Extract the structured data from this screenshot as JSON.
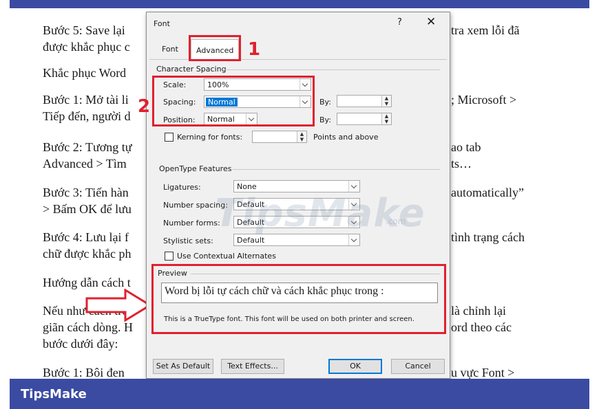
{
  "background": {
    "lines": [
      {
        "id": "l1a",
        "text": "Bước 5: Save lại"
      },
      {
        "id": "l1b",
        "text": "được khắc phục c"
      },
      {
        "id": "r1",
        "text": "tra xem lỗi đã"
      },
      {
        "id": "l2",
        "text": "Khắc phục Word"
      },
      {
        "id": "l3a",
        "text": "Bước 1: Mở tài li"
      },
      {
        "id": "l3b",
        "text": "Tiếp đến, người d"
      },
      {
        "id": "r3",
        "text": "; Microsoft >"
      },
      {
        "id": "l4a",
        "text": "Bước 2: Tương tự"
      },
      {
        "id": "l4b",
        "text": "Advanced > Tìm"
      },
      {
        "id": "r4a",
        "text": "ao tab"
      },
      {
        "id": "r4b",
        "text": "ts…"
      },
      {
        "id": "l5a",
        "text": "Bước 3: Tiến hàn"
      },
      {
        "id": "l5b",
        "text": "> Bấm OK để lưu"
      },
      {
        "id": "r5",
        "text": "automatically”"
      },
      {
        "id": "l6a",
        "text": "Bước 4: Lưu lại f"
      },
      {
        "id": "l6b",
        "text": "chữ được khắc ph"
      },
      {
        "id": "r6",
        "text": "tình trạng cách"
      },
      {
        "id": "l7",
        "text": "Hướng dẫn cách t"
      },
      {
        "id": "l8a",
        "text": "Nếu như cách trê"
      },
      {
        "id": "l8b",
        "text": "giãn cách dòng. H"
      },
      {
        "id": "l8c",
        "text": "bước dưới đây:"
      },
      {
        "id": "r8a",
        "text": "là chỉnh lại"
      },
      {
        "id": "r8b",
        "text": "ord theo các"
      },
      {
        "id": "l9",
        "text": "Bước 1: Bôi đen"
      },
      {
        "id": "r9",
        "text": "u vực Font >"
      }
    ]
  },
  "footer": {
    "brand": "TipsMake"
  },
  "watermark": {
    "text": "TipsMake",
    "suffix": ".com"
  },
  "markers": {
    "one": "1",
    "two": "2"
  },
  "dialog": {
    "title": "Font",
    "help": "?",
    "close": "✕",
    "tabs": {
      "font": "Font",
      "advanced": "Advanced"
    },
    "character_spacing": {
      "heading": "Character Spacing",
      "scale_label": "Scale:",
      "scale_value": "100%",
      "spacing_label": "Spacing:",
      "spacing_value": "Normal",
      "position_label": "Position:",
      "position_value": "Normal",
      "by_label_1": "By:",
      "by_label_2": "By:",
      "kerning_label": "Kerning for fonts:",
      "kerning_suffix": "Points and above"
    },
    "opentype": {
      "heading": "OpenType Features",
      "ligatures_label": "Ligatures:",
      "ligatures_value": "None",
      "number_spacing_label": "Number spacing:",
      "number_spacing_value": "Default",
      "number_forms_label": "Number forms:",
      "number_forms_value": "Default",
      "stylistic_label": "Stylistic sets:",
      "stylistic_value": "Default",
      "contextual_label": "Use Contextual Alternates"
    },
    "preview": {
      "heading": "Preview",
      "sample": "Word bị lỗi tự cách chữ và cách khắc phục trong :",
      "note": "This is a TrueType font. This font will be used on both printer and screen."
    },
    "buttons": {
      "set_default": "Set As Default",
      "text_effects": "Text Effects...",
      "ok": "OK",
      "cancel": "Cancel"
    }
  },
  "colors": {
    "annotation": "#e0202e",
    "brand_bar": "#3b4ba1",
    "selection": "#0078d7"
  }
}
